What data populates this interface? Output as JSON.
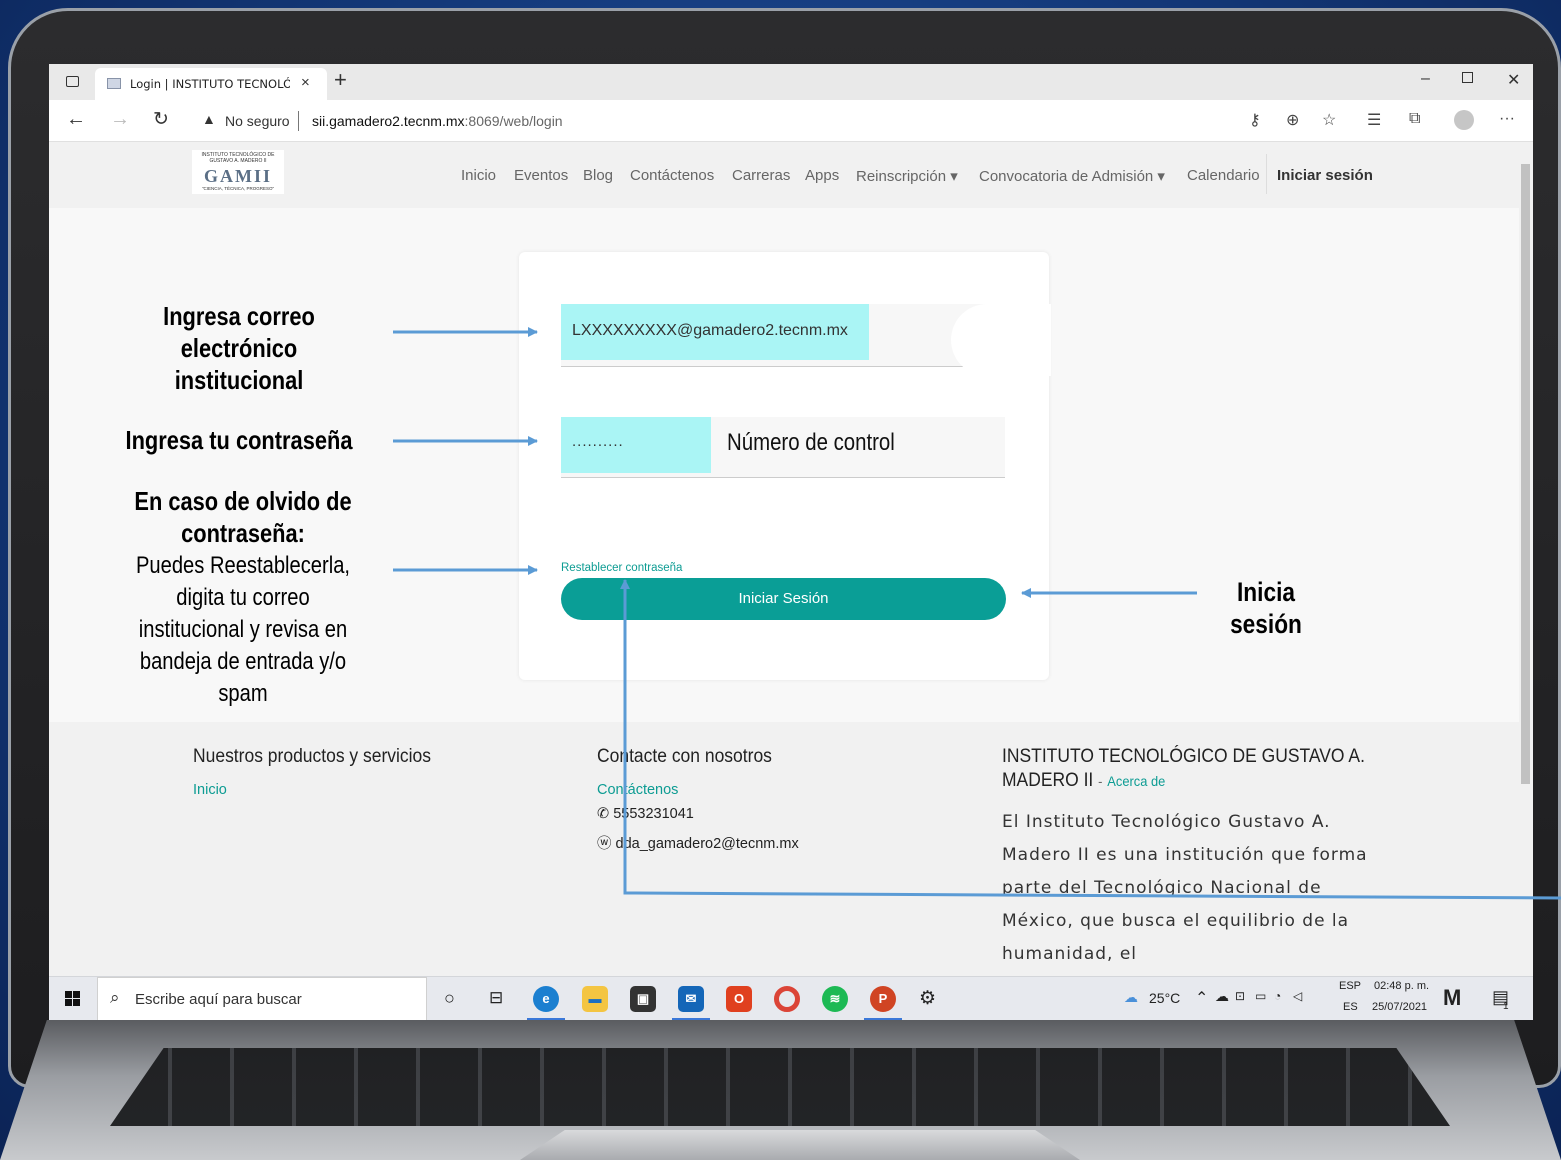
{
  "browser": {
    "tab_title": "Login | INSTITUTO TECNOLÓGICO",
    "tab_close": "×",
    "new_tab": "+",
    "security_label": "No seguro",
    "url_host": "sii.gamadero2.tecnm.mx",
    "url_path": ":8069/web/login"
  },
  "site": {
    "logo_arc": "INSTITUTO TECNOLÓGICO DE GUSTAVO A. MADERO II",
    "logo_mark": "GAMII",
    "logo_motto": "\"CIENCIA, TÉCNICA, PROGRESO\"",
    "menu": [
      {
        "label": "Inicio"
      },
      {
        "label": "Eventos"
      },
      {
        "label": "Blog"
      },
      {
        "label": "Contáctenos"
      },
      {
        "label": "Carreras"
      },
      {
        "label": "Apps"
      },
      {
        "label": "Reinscripción ▾"
      },
      {
        "label": "Convocatoria de Admisión ▾"
      },
      {
        "label": "Calendario"
      },
      {
        "label": "Iniciar sesión"
      }
    ]
  },
  "login": {
    "email_value": "LXXXXXXXXX@gamadero2.tecnm.mx",
    "password_value": "..........",
    "password_overlay": "Número de control",
    "reset_link": "Restablecer contraseña",
    "submit_label": "Iniciar Sesión"
  },
  "footer": {
    "col1_title": "Nuestros productos y servicios",
    "col1_link": "Inicio",
    "col2_title": "Contacte con nosotros",
    "col2_link": "Contáctenos",
    "col2_phone": "5553231041",
    "col2_email": "dda_gamadero2@tecnm.mx",
    "col3_title_line1": "INSTITUTO TECNOLÓGICO DE GUSTAVO A.",
    "col3_title_line2": "MADERO II",
    "col3_sep": "-",
    "col3_link": "Acerca de",
    "about": "El Instituto Tecnológico Gustavo A. Madero II es una institución que forma parte del Tecnológico Nacional de México, que busca el equilibrio de la humanidad, el"
  },
  "taskbar": {
    "search_placeholder": "Escribe aquí para buscar",
    "weather": "25°C",
    "lang_top": "ESP",
    "lang_bottom": "ES",
    "time": "02:48 p. m.",
    "date": "25/07/2021",
    "notification_count": "1"
  },
  "annotations": {
    "email_line1": "Ingresa correo",
    "email_line2": "electrónico institucional",
    "password": "Ingresa tu contraseña",
    "forgot_line1": "En caso de olvido de",
    "forgot_line2": "contraseña:",
    "forgot_body": [
      "Puedes Reestablecerla,",
      "digita tu correo",
      "institucional y revisa en",
      "bandeja de entrada y/o",
      "spam"
    ],
    "login": "Inicia sesión"
  },
  "colors": {
    "accent": "#0a9e96",
    "highlight": "#aaf5f5",
    "arrow": "#5b9bd5"
  }
}
